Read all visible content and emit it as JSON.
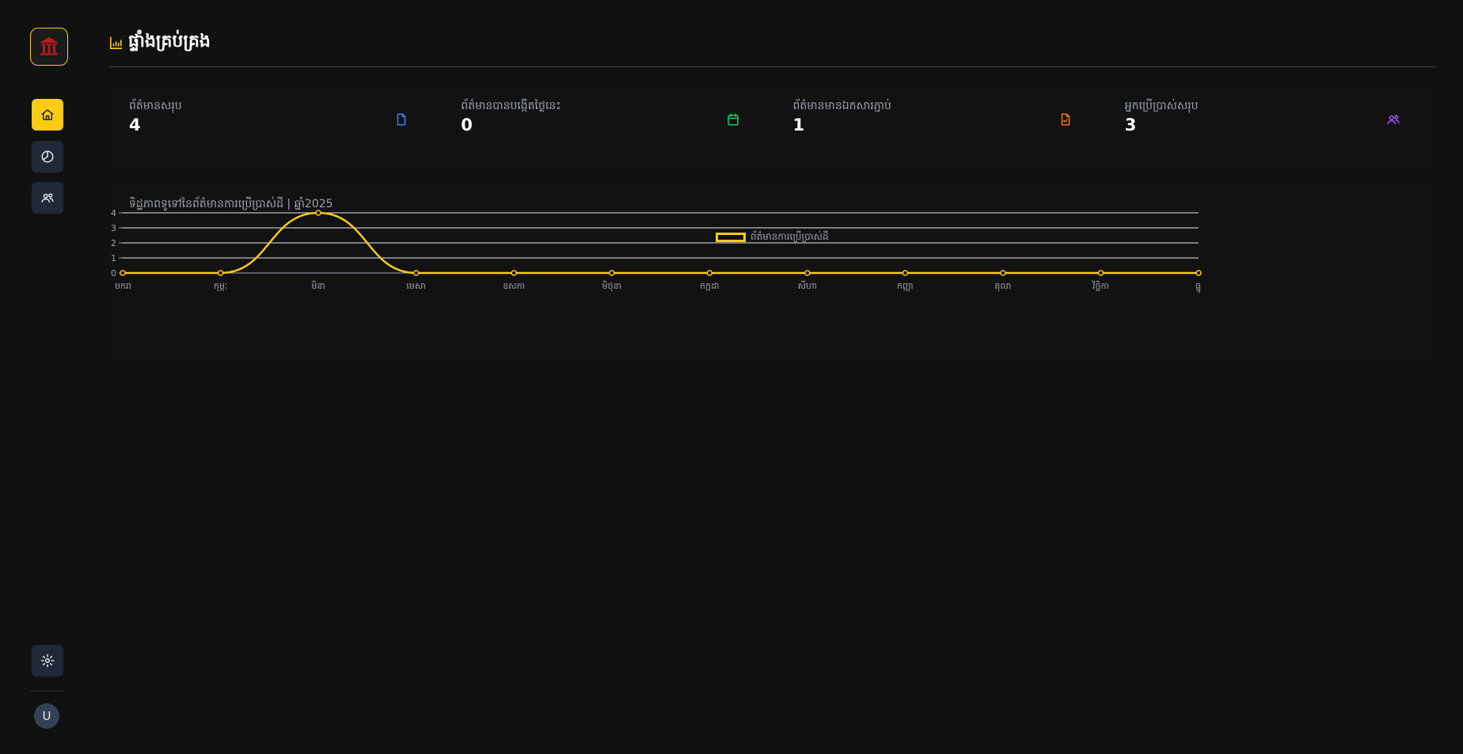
{
  "sidebar": {
    "logo": "building-logo",
    "nav": [
      {
        "name": "home",
        "icon": "home-icon",
        "active": true
      },
      {
        "name": "reports",
        "icon": "pie-chart-icon",
        "active": false
      },
      {
        "name": "users",
        "icon": "users-icon",
        "active": false
      }
    ],
    "settings_icon": "gear-icon",
    "avatar_initial": "U"
  },
  "header": {
    "title": "ផ្ទាំងគ្រប់គ្រង",
    "icon": "bar-chart-icon"
  },
  "stats": [
    {
      "label": "ព័ត៌មានសរុប",
      "value": "4",
      "icon": "file-icon",
      "color": "#3b82f6"
    },
    {
      "label": "ព័ត៌មានបានបង្កើតថ្ងៃនេះ",
      "value": "0",
      "icon": "calendar-icon",
      "color": "#22c55e"
    },
    {
      "label": "ព័ត៌មានមានឯកសារភ្ជាប់",
      "value": "1",
      "icon": "file-check-icon",
      "color": "#f97316"
    },
    {
      "label": "អ្នកប្រើប្រាស់សរុប",
      "value": "3",
      "icon": "users-icon",
      "color": "#a855f7"
    }
  ],
  "chart": {
    "title": "ទិដ្ឋភាពទូទៅនៃព័ត៌មានការប្រើប្រាស់ដី | ឆ្នាំ2025"
  },
  "chart_data": {
    "type": "line",
    "title": "ទិដ្ឋភាពទូទៅនៃព័ត៌មានការប្រើប្រាស់ដី | ឆ្នាំ2025",
    "categories": [
      "មករា",
      "កុម្ភៈ",
      "មិនា",
      "មេសា",
      "ឧសភា",
      "មិថុនា",
      "កក្កដា",
      "សីហា",
      "កញ្ញា",
      "តុលា",
      "វិច្ឆិកា",
      "ធ្នូ"
    ],
    "series": [
      {
        "name": "ព័ត៌មានការប្រើប្រាស់ដី",
        "values": [
          0,
          0,
          4,
          0,
          0,
          0,
          0,
          0,
          0,
          0,
          0,
          0
        ],
        "color": "#facc15"
      }
    ],
    "yticks": [
      0,
      1,
      2,
      3,
      4
    ],
    "ylim": [
      0,
      4
    ],
    "grid": true,
    "legend": "top-center"
  }
}
